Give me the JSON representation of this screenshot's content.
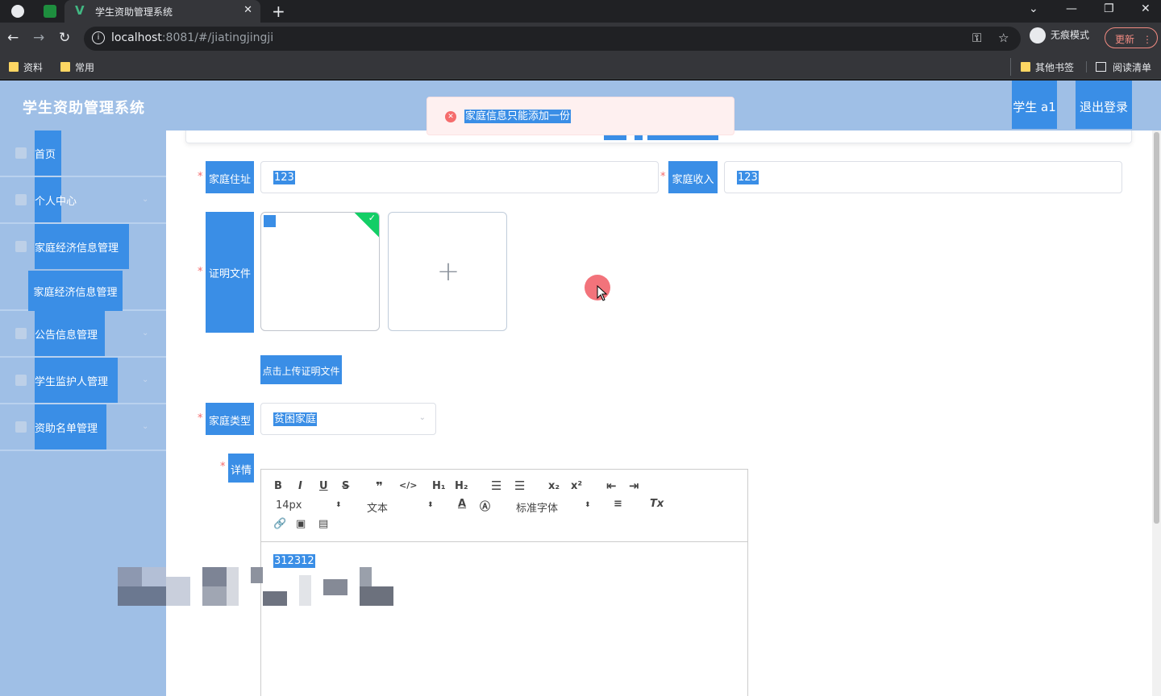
{
  "browser": {
    "tab_title": "学生资助管理系统",
    "tab_logo": "V",
    "tab_close": "✕",
    "new_tab": "+",
    "url_host": "localhost",
    "url_rest": ":8081/#/jiatingjingji",
    "incognito_label": "无痕模式",
    "update_label": "更新",
    "bookmarks": [
      "资料",
      "常用"
    ],
    "other_bookmarks": "其他书签",
    "reading_list": "阅读清单"
  },
  "app": {
    "title": "学生资助管理系统",
    "user_button": "学生 a1",
    "logout_button": "退出登录"
  },
  "sidebar": {
    "items": [
      {
        "label": "首页",
        "icon": "home-icon"
      },
      {
        "label": "个人中心",
        "icon": "user-icon"
      },
      {
        "label": "家庭经济信息管理",
        "icon": "document-icon"
      },
      {
        "label": "公告信息管理",
        "icon": "briefcase-icon"
      },
      {
        "label": "学生监护人管理",
        "icon": "chart-icon"
      },
      {
        "label": "资助名单管理",
        "icon": "list-icon"
      }
    ],
    "submenu": {
      "label": "家庭经济信息管理"
    }
  },
  "form": {
    "address_label": "家庭住址",
    "address_value": "123",
    "income_label": "家庭收入",
    "income_value": "123",
    "proof_label": "证明文件",
    "upload_button": "点击上传证明文件",
    "family_type_label": "家庭类型",
    "family_type_value": "贫困家庭",
    "detail_label": "详情",
    "required_mark": "*"
  },
  "editor": {
    "font_size": "14px",
    "block_type": "文本",
    "font_family": "标准字体",
    "content": "312312"
  },
  "toast": {
    "message": "家庭信息只能添加一份"
  },
  "colors": {
    "accent": "#3a8ee6",
    "header_bg": "#9fbfe6",
    "error": "#f56c6c",
    "success": "#13ce66"
  }
}
